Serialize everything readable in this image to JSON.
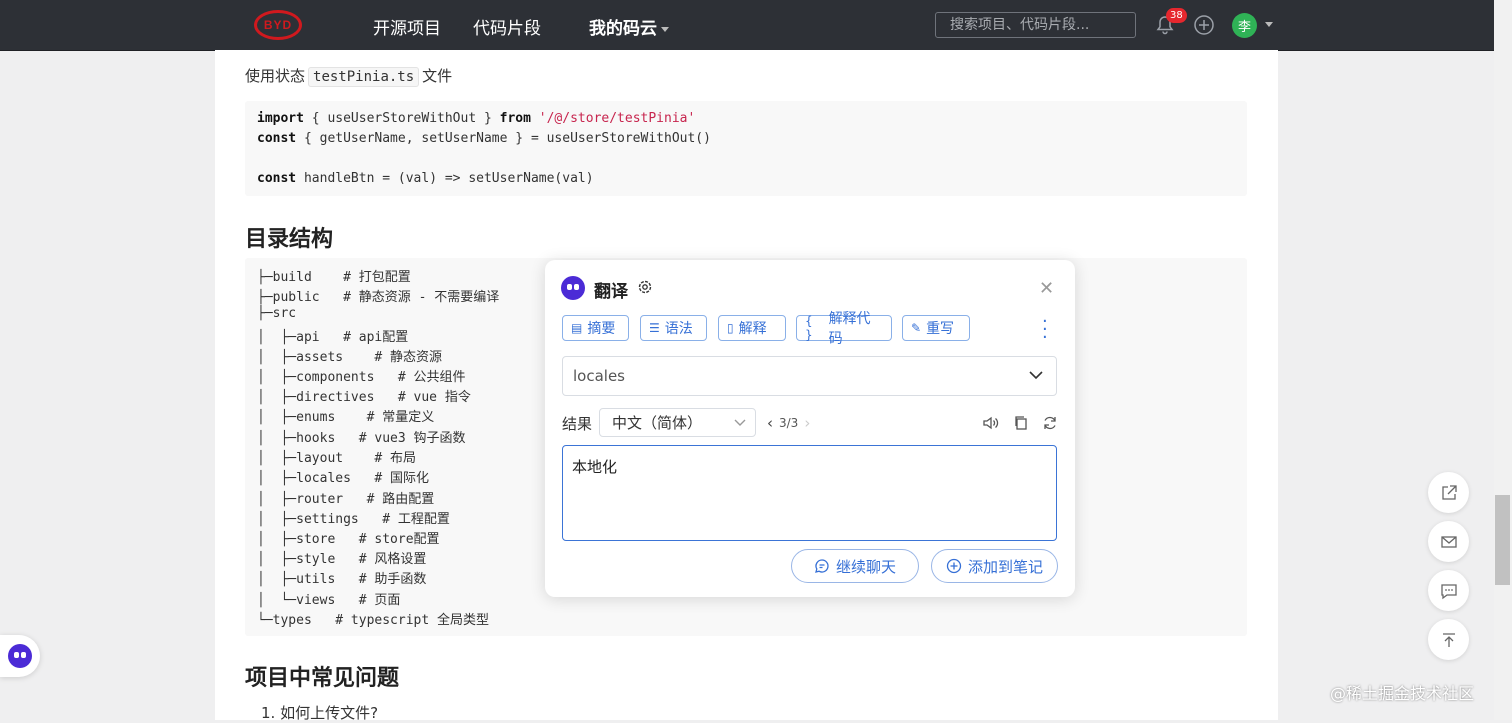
{
  "nav": {
    "logo_text": "BYD",
    "links": [
      "开源项目",
      "代码片段",
      "我的码云"
    ],
    "search_placeholder": "搜索项目、代码片段...",
    "notification_count": "38",
    "avatar_text": "李"
  },
  "article": {
    "usage_prefix": "使用状态",
    "usage_file": "testPinia.ts",
    "usage_suffix": "文件",
    "code": {
      "l1_import": "import",
      "l1_mid": " { useUserStoreWithOut } ",
      "l1_from": "from",
      "l1_str": "'/@/store/testPinia'",
      "l2_const": "const",
      "l2_rest": " { getUserName, setUserName } = useUserStoreWithOut()",
      "l4_const": "const",
      "l4_rest": " handleBtn = (val) => setUserName(val)"
    },
    "heading_dir": "目录结构",
    "tree": [
      "├─build    # 打包配置",
      "├─public   # 静态资源 - 不需要编译",
      "├─src",
      "│  ├─api   # api配置",
      "│  ├─assets    # 静态资源",
      "│  ├─components   # 公共组件",
      "│  ├─directives   # vue 指令",
      "│  ├─enums    # 常量定义",
      "│  ├─hooks   # vue3 钩子函数",
      "│  ├─layout    # 布局",
      "│  ├─locales   # 国际化",
      "│  ├─router   # 路由配置",
      "│  ├─settings   # 工程配置",
      "│  ├─store   # store配置",
      "│  ├─style   # 风格设置",
      "│  ├─utils   # 助手函数",
      "│  └─views   # 页面",
      "└─types   # typescript 全局类型"
    ],
    "heading_faq": "项目中常见问题",
    "faq_item1": "1. 如何上传文件?"
  },
  "translate": {
    "title": "翻译",
    "actions": [
      "摘要",
      "语法",
      "解释",
      "解释代码",
      "重写"
    ],
    "source_text": "locales",
    "result_label": "结果",
    "target_language": "中文（简体）",
    "pager": "3/3",
    "result_text": "本地化",
    "continue_chat": "继续聊天",
    "add_to_notes": "添加到笔记"
  },
  "watermark": "@稀土掘金技术社区"
}
